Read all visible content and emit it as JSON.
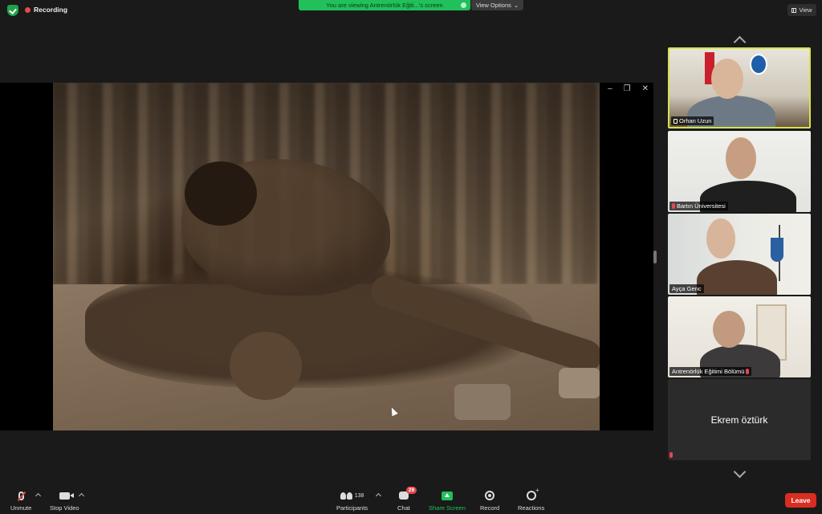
{
  "top_bar": {
    "recording_label": "Recording",
    "viewing_banner": "You are viewing Antrenörlük Eğiti...'s screen",
    "view_options_label": "View Options",
    "view_button_label": "View"
  },
  "shared_screen": {
    "window_controls": [
      "–",
      "❐",
      "✕"
    ]
  },
  "gallery": {
    "participants": [
      {
        "name": "Orhan Uzun",
        "active_speaker": true,
        "pinned": true
      },
      {
        "name": "Bartın Üniversitesi",
        "muted": true
      },
      {
        "name": "Ayça Genc",
        "muted": false
      },
      {
        "name": "Antrenörlük Eğitimi Bölümü",
        "muted": true
      },
      {
        "name": "Ekrem öztürk",
        "video_off": true,
        "muted": true
      }
    ]
  },
  "toolbar": {
    "unmute_label": "Unmute",
    "stop_video_label": "Stop Video",
    "participants_label": "Participants",
    "participants_count": "138",
    "chat_label": "Chat",
    "chat_badge": "29",
    "share_screen_label": "Share Screen",
    "record_label": "Record",
    "reactions_label": "Reactions",
    "leave_label": "Leave"
  },
  "colors": {
    "accent_green": "#21c05a",
    "leave_red": "#d92d20",
    "active_speaker_border": "#d6e34a"
  }
}
